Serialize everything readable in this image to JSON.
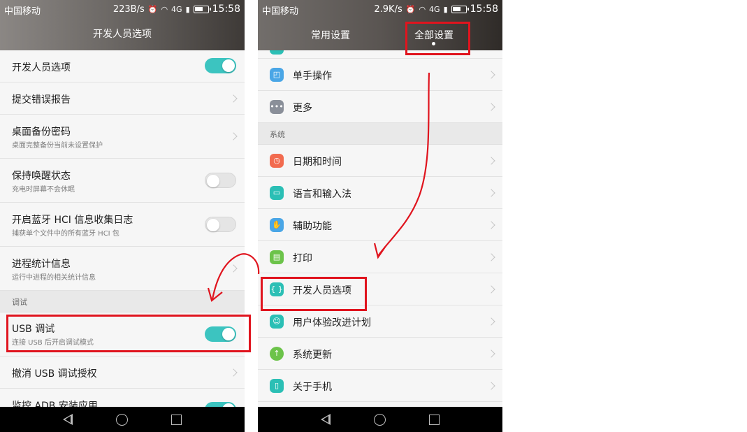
{
  "left_phone": {
    "status": {
      "carrier": "中国移动",
      "speed": "223B/s",
      "network": "4G",
      "time": "15:58"
    },
    "title": "开发人员选项",
    "rows": [
      {
        "title": "开发人员选项",
        "control": "toggle-on"
      },
      {
        "title": "提交错误报告",
        "control": "chevron"
      },
      {
        "title": "桌面备份密码",
        "subtitle": "桌面完整备份当前未设置保护",
        "control": "chevron"
      },
      {
        "title": "保持唤醒状态",
        "subtitle": "充电时屏幕不会休眠",
        "control": "toggle-off"
      },
      {
        "title": "开启蓝牙 HCI 信息收集日志",
        "subtitle": "捕获单个文件中的所有蓝牙 HCI 包",
        "control": "toggle-off"
      },
      {
        "title": "进程统计信息",
        "subtitle": "运行中进程的相关统计信息",
        "control": "chevron"
      }
    ],
    "section_debug": "调试",
    "usb_debug": {
      "title": "USB 调试",
      "subtitle": "连接 USB 后开启调试模式",
      "enabled": true
    },
    "revoke_usb": "撤消 USB 调试授权",
    "monitor_adb": "监控 ADB 安装应用"
  },
  "right_phone": {
    "status": {
      "carrier": "中国移动",
      "speed": "2.9K/s",
      "network": "4G",
      "time": "15:58"
    },
    "tabs": {
      "common": "常用设置",
      "all": "全部设置"
    },
    "items_top": [
      {
        "label": "单手操作",
        "icon": "one-hand-icon",
        "color": "#4aa6e6"
      },
      {
        "label": "更多",
        "icon": "more-icon",
        "color": "#8a8f99"
      }
    ],
    "section_system": "系统",
    "items_system": [
      {
        "label": "日期和时间",
        "icon": "clock-icon",
        "color": "#f26b4f"
      },
      {
        "label": "语言和输入法",
        "icon": "keyboard-icon",
        "color": "#2bbfb5"
      },
      {
        "label": "辅助功能",
        "icon": "hand-icon",
        "color": "#4aa6e6"
      },
      {
        "label": "打印",
        "icon": "printer-icon",
        "color": "#6cc34a"
      },
      {
        "label": "开发人员选项",
        "icon": "developer-icon",
        "color": "#2bbfb5"
      },
      {
        "label": "用户体验改进计划",
        "icon": "user-icon",
        "color": "#2bbfb5"
      },
      {
        "label": "系统更新",
        "icon": "update-icon",
        "color": "#6cc34a"
      },
      {
        "label": "关于手机",
        "icon": "phone-icon",
        "color": "#2bbfb5"
      }
    ]
  },
  "annotation_color": "#e0141e",
  "accent": "#3cc4c0"
}
